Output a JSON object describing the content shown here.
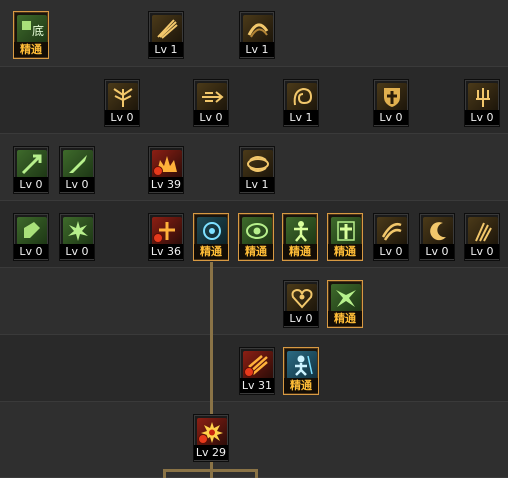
{
  "skill_tree": {
    "rows": [
      [
        {
          "name": "skill-row1-col1",
          "icon": "green-tile-icon",
          "color": "green",
          "label": "精通",
          "mastered": true
        },
        {
          "name": "skill-row1-col2",
          "icon": "gold-slash-icon",
          "color": "gold",
          "label": "Lv 1",
          "mastered": false
        },
        {
          "name": "skill-row1-col3",
          "icon": "gold-swirl-icon",
          "color": "gold",
          "label": "Lv 1",
          "mastered": false
        }
      ],
      [
        {
          "name": "skill-row2-col1",
          "icon": "gold-wings-icon",
          "color": "gold",
          "label": "Lv 0",
          "mastered": false
        },
        {
          "name": "skill-row2-col2",
          "icon": "gold-dash-icon",
          "color": "gold",
          "label": "Lv 0",
          "mastered": false
        },
        {
          "name": "skill-row2-col3",
          "icon": "gold-spiral-icon",
          "color": "gold",
          "label": "Lv 1",
          "mastered": false
        },
        {
          "name": "skill-row2-col4",
          "icon": "gold-shield-icon",
          "color": "gold",
          "label": "Lv 0",
          "mastered": false
        },
        {
          "name": "skill-row2-col5",
          "icon": "gold-trident-icon",
          "color": "gold",
          "label": "Lv 0",
          "mastered": false
        }
      ],
      [
        {
          "name": "skill-row3-col1",
          "icon": "green-arrow-icon",
          "color": "green",
          "label": "Lv 0",
          "mastered": false
        },
        {
          "name": "skill-row3-col2",
          "icon": "green-blade-icon",
          "color": "green",
          "label": "Lv 0",
          "mastered": false
        },
        {
          "name": "skill-row3-col3",
          "icon": "red-crown-icon",
          "color": "red",
          "label": "Lv 39",
          "mastered": false,
          "badge": true
        },
        {
          "name": "skill-row3-col4",
          "icon": "gold-vortex-icon",
          "color": "gold",
          "label": "Lv 1",
          "mastered": false
        }
      ],
      [
        {
          "name": "skill-row4-col1",
          "icon": "green-square-icon",
          "color": "green",
          "label": "Lv 0",
          "mastered": false
        },
        {
          "name": "skill-row4-col2",
          "icon": "green-burst-icon",
          "color": "green",
          "label": "Lv 0",
          "mastered": false
        },
        {
          "name": "skill-row4-col3",
          "icon": "red-cross-icon",
          "color": "red",
          "label": "Lv 36",
          "mastered": false,
          "badge": true
        },
        {
          "name": "skill-row4-col4",
          "icon": "green-orb-icon",
          "color": "green",
          "label": "精通",
          "mastered": true
        },
        {
          "name": "skill-row4-col5",
          "icon": "green-eye-icon",
          "color": "green",
          "label": "精通",
          "mastered": true
        },
        {
          "name": "skill-row4-col6",
          "icon": "green-figure-icon",
          "color": "green",
          "label": "精通",
          "mastered": true
        },
        {
          "name": "skill-row4-col7",
          "icon": "green-holy-cross-icon",
          "color": "green",
          "label": "精通",
          "mastered": true
        },
        {
          "name": "skill-row4-col8",
          "icon": "gold-wave-icon",
          "color": "gold",
          "label": "Lv 0",
          "mastered": false
        },
        {
          "name": "skill-row4-col9",
          "icon": "gold-crescent-icon",
          "color": "gold",
          "label": "Lv 0",
          "mastered": false
        },
        {
          "name": "skill-row4-col10",
          "icon": "gold-streak-icon",
          "color": "gold",
          "label": "Lv 0",
          "mastered": false
        }
      ],
      [
        {
          "name": "skill-row5-col1",
          "icon": "gold-heart-icon",
          "color": "gold",
          "label": "Lv 0",
          "mastered": false
        },
        {
          "name": "skill-row5-col2",
          "icon": "green-splash-icon",
          "color": "green",
          "label": "精通",
          "mastered": true
        }
      ],
      [
        {
          "name": "skill-row6-col1",
          "icon": "red-flare-icon",
          "color": "red",
          "label": "Lv 31",
          "mastered": false,
          "badge": true
        },
        {
          "name": "skill-row6-col2",
          "icon": "blue-warrior-icon",
          "color": "blue",
          "label": "精通",
          "mastered": true
        }
      ],
      [
        {
          "name": "skill-row7-col1",
          "icon": "red-explosion-icon",
          "color": "red",
          "label": "Lv 29",
          "mastered": false,
          "badge": true
        }
      ]
    ]
  }
}
